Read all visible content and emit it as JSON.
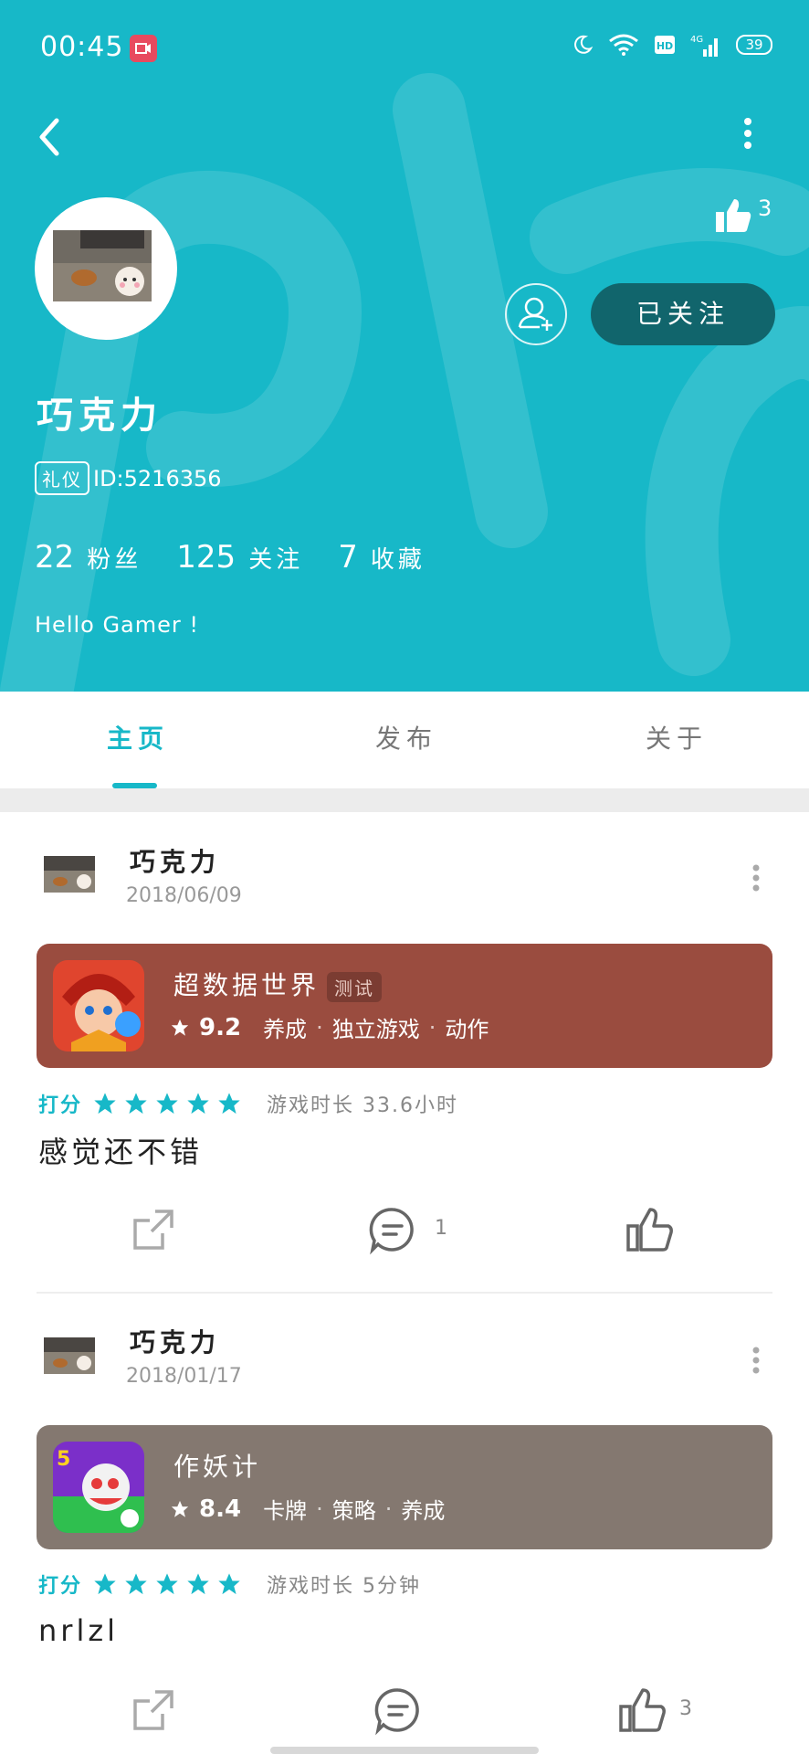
{
  "status_bar": {
    "time": "00:45",
    "battery": "39"
  },
  "profile": {
    "likes": "3",
    "follow_button": "已关注",
    "nickname": "巧克力",
    "badge": "礼仪",
    "user_id": "ID:5216356",
    "stats": [
      {
        "value": "22",
        "label": "粉丝"
      },
      {
        "value": "125",
        "label": "关注"
      },
      {
        "value": "7",
        "label": "收藏"
      }
    ],
    "bio": "Hello Gamer !"
  },
  "tabs": [
    "主页",
    "发布",
    "关于"
  ],
  "active_tab": "主页",
  "posts": [
    {
      "author": "巧克力",
      "date": "2018/06/09",
      "game": {
        "title": "超数据世界",
        "tag": "测试",
        "score": "9.2",
        "genres": [
          "养成",
          "独立游戏",
          "动作"
        ],
        "card_color": "#9a4c3f"
      },
      "rating_label": "打分",
      "stars": 5,
      "playtime": "游戏时长 33.6小时",
      "text": "感觉还不错",
      "comment_count": "1",
      "like_count": ""
    },
    {
      "author": "巧克力",
      "date": "2018/01/17",
      "game": {
        "title": "作妖计",
        "tag": "",
        "score": "8.4",
        "genres": [
          "卡牌",
          "策略",
          "养成"
        ],
        "card_color": "#847870"
      },
      "rating_label": "打分",
      "stars": 5,
      "playtime": "游戏时长 5分钟",
      "text": "nrlzl",
      "comment_count": "",
      "like_count": "3"
    }
  ]
}
